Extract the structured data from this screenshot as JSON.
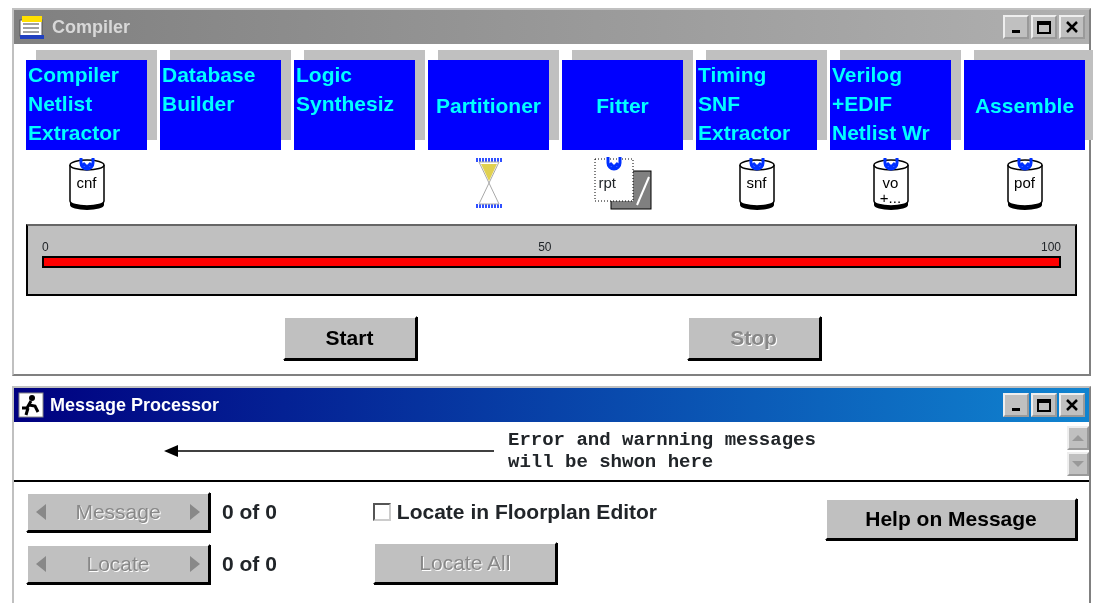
{
  "compiler_window": {
    "title": "Compiler",
    "active": false,
    "stages": [
      {
        "lines": [
          "Compiler",
          "Netlist",
          "Extractor"
        ],
        "icon": {
          "kind": "database",
          "file": "cnf"
        }
      },
      {
        "lines": [
          "Database",
          "Builder"
        ]
      },
      {
        "lines": [
          "Logic",
          "Synthesiz"
        ]
      },
      {
        "lines": [
          "Partitioner"
        ],
        "icon": {
          "kind": "hourglass"
        }
      },
      {
        "lines": [
          "Fitter"
        ],
        "icon": {
          "kind": "report",
          "file": "rpt"
        }
      },
      {
        "lines": [
          "Timing",
          "SNF",
          "Extractor"
        ],
        "icon": {
          "kind": "database",
          "file": "snf"
        }
      },
      {
        "lines": [
          "Verilog",
          "+EDIF",
          "Netlist Wr"
        ],
        "icon": {
          "kind": "database",
          "file": "vo +..."
        }
      },
      {
        "lines": [
          "Assemble"
        ],
        "icon": {
          "kind": "database",
          "file": "pof"
        }
      }
    ],
    "progress": {
      "level": 1,
      "ticks": [
        "0",
        "50",
        "100"
      ]
    },
    "buttons": [
      {
        "label": "Start",
        "disabled": false
      },
      {
        "label": "Stop",
        "disabled": true
      }
    ]
  },
  "message_window": {
    "title": "Message Processor",
    "active": true,
    "message_lines": [
      "Error and warnning messages",
      "will be shwon here"
    ],
    "navigators": [
      {
        "label": "Message",
        "disabled": true,
        "count": "0 of 0"
      },
      {
        "label": "Locate",
        "disabled": true,
        "count": "0 of 0"
      }
    ],
    "checkbox": {
      "label": "Locate in Floorplan Editor",
      "checked": false
    },
    "buttons": [
      {
        "label": "Help on Message",
        "disabled": false
      },
      {
        "label": "Locate All",
        "disabled": true
      }
    ]
  }
}
